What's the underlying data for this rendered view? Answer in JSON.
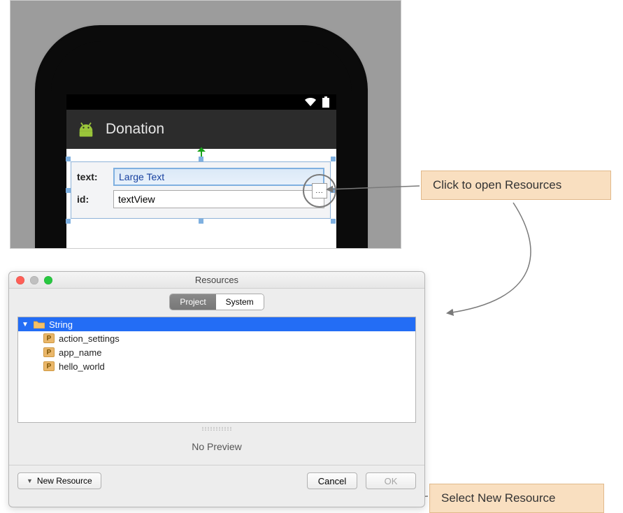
{
  "editor": {
    "app_title": "Donation",
    "property_text_label": "text:",
    "property_text_value": "Large Text",
    "property_id_label": "id:",
    "property_id_value": "textView",
    "browse_button_label": "..."
  },
  "callouts": {
    "open_resources": "Click to open Resources",
    "new_resource": "Select New Resource"
  },
  "dialog": {
    "title": "Resources",
    "tabs": {
      "project": "Project",
      "system": "System"
    },
    "tree": {
      "root": "String",
      "items": [
        "action_settings",
        "app_name",
        "hello_world"
      ]
    },
    "preview_text": "No Preview",
    "footer": {
      "new_resource": "New Resource",
      "cancel": "Cancel",
      "ok": "OK"
    }
  }
}
